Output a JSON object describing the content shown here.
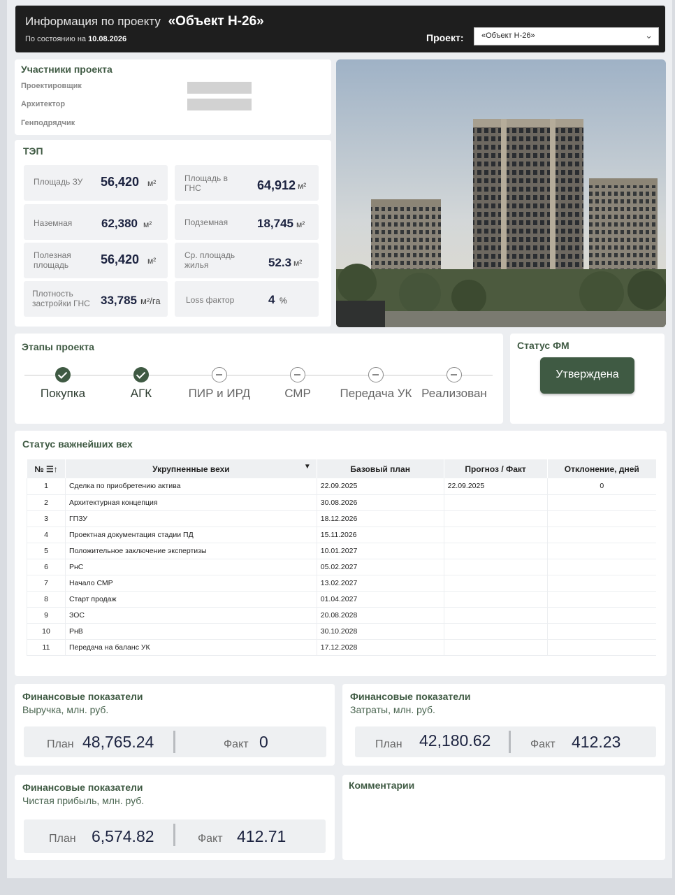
{
  "header": {
    "title_prefix": "Информация по проекту",
    "title_project": "«Объект Н-26»",
    "as_of_prefix": "По состоянию на",
    "as_of_date": "10.08.2026",
    "project_label": "Проект:",
    "project_select_value": "«Объект Н-26»"
  },
  "participants": {
    "title": "Участники проекта",
    "rows": [
      "Проектировщик",
      "Архитектор",
      "Генподрядчик"
    ]
  },
  "tep": {
    "title": "ТЭП",
    "items": [
      {
        "label": "Площадь ЗУ",
        "value": "56,420",
        "unit": "м²"
      },
      {
        "label": "Площадь в ГНС",
        "value": "64,912",
        "unit": "м²"
      },
      {
        "label": "Наземная",
        "value": "62,380",
        "unit": "м²"
      },
      {
        "label": "Подземная",
        "value": "18,745",
        "unit": "м²"
      },
      {
        "label": "Полезная площадь",
        "value": "56,420",
        "unit": "м²"
      },
      {
        "label": "Ср. площадь жилья",
        "value": "52.3",
        "unit": "м²"
      },
      {
        "label": "Плотность застройки ГНС",
        "value": "33,785",
        "unit": "м²/га"
      },
      {
        "label": "Loss фактор",
        "value": "4",
        "unit": "%"
      }
    ]
  },
  "stages": {
    "title": "Этапы проекта",
    "items": [
      {
        "label": "Покупка",
        "done": true
      },
      {
        "label": "АГК",
        "done": true
      },
      {
        "label": "ПИР и ИРД",
        "done": false
      },
      {
        "label": "СМР",
        "done": false
      },
      {
        "label": "Передача УК",
        "done": false
      },
      {
        "label": "Реализован",
        "done": false
      }
    ]
  },
  "fm_status": {
    "title": "Статус ФМ",
    "value": "Утверждена"
  },
  "milestones": {
    "title": "Статус важнейших вех",
    "columns": [
      "№",
      "Укрупненные вехи",
      "Базовый план",
      "Прогноз / Факт",
      "Отклонение, дней"
    ],
    "rows": [
      [
        "1",
        "Сделка по приобретению актива",
        "22.09.2025",
        "22.09.2025",
        "0"
      ],
      [
        "2",
        "Архитектурная концепция",
        "30.08.2026",
        "",
        ""
      ],
      [
        "3",
        "ГПЗУ",
        "18.12.2026",
        "",
        ""
      ],
      [
        "4",
        "Проектная документация стадии ПД",
        "15.11.2026",
        "",
        ""
      ],
      [
        "5",
        "Положительное заключение экспертизы",
        "10.01.2027",
        "",
        ""
      ],
      [
        "6",
        "РнС",
        "05.02.2027",
        "",
        ""
      ],
      [
        "7",
        "Начало СМР",
        "13.02.2027",
        "",
        ""
      ],
      [
        "8",
        "Старт продаж",
        "01.04.2027",
        "",
        ""
      ],
      [
        "9",
        "ЗОС",
        "20.08.2028",
        "",
        ""
      ],
      [
        "10",
        "РнВ",
        "30.10.2028",
        "",
        ""
      ],
      [
        "11",
        "Передача на баланс УК",
        "17.12.2028",
        "",
        ""
      ]
    ]
  },
  "finance": {
    "revenue": {
      "title": "Финансовые показатели",
      "subtitle": "Выручка, млн. руб.",
      "plan_label": "План",
      "plan": "48,765.24",
      "fact_label": "Факт",
      "fact": "0"
    },
    "costs": {
      "title": "Финансовые показатели",
      "subtitle": "Затраты, млн. руб.",
      "plan_label": "План",
      "plan": "42,180.62",
      "fact_label": "Факт",
      "fact": "412.23"
    },
    "profit": {
      "title": "Финансовые показатели",
      "subtitle": "Чистая прибыль, млн. руб.",
      "plan_label": "План",
      "plan": "6,574.82",
      "fact_label": "Факт",
      "fact": "412.71"
    }
  },
  "comments": {
    "title": "Комментарии"
  },
  "colors": {
    "accent": "#3f5a43",
    "header_bg": "#1e1e1e",
    "value_text": "#1c2340"
  }
}
